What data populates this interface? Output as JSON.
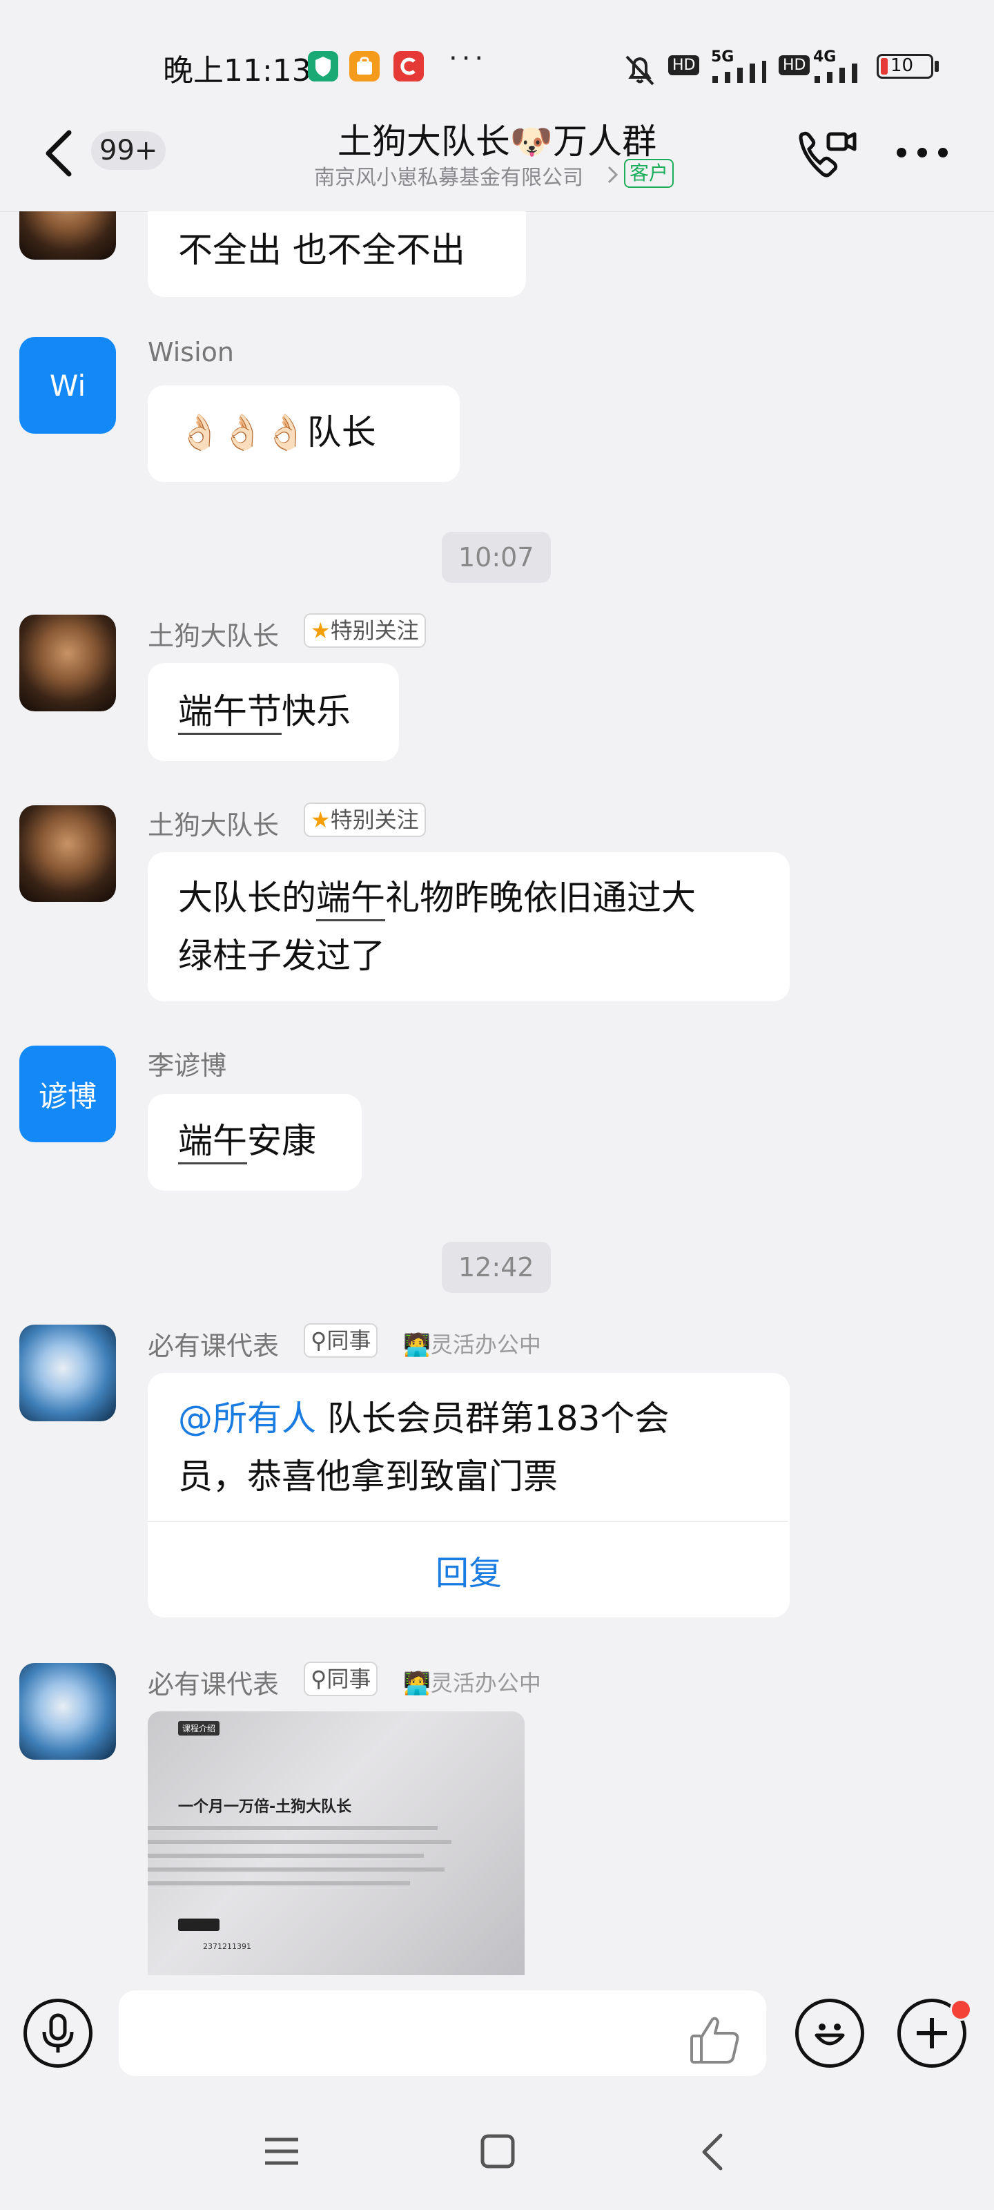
{
  "status_bar": {
    "time": "晚上11:13",
    "dots": "···",
    "net1": "5G",
    "net2": "4G",
    "battery": "10"
  },
  "header": {
    "unread_count": "99+",
    "title": "土狗大队长🐶万人群",
    "subtitle": "南京风小崽私募基金有限公司",
    "customer_tag": "客户"
  },
  "messages": [
    {
      "type": "text",
      "text": "不全出 也不全不出"
    },
    {
      "avatar_text": "Wi",
      "sender": "Wision",
      "text": "👌🏻👌🏻👌🏻队长"
    },
    {
      "type": "time",
      "text": "10:07"
    },
    {
      "sender": "土狗大队长",
      "tag": "特别关注",
      "underline": "端午节",
      "rest": "快乐"
    },
    {
      "sender": "土狗大队长",
      "tag": "特别关注",
      "line1_pre": "大队长的",
      "line1_ul": "端午",
      "line1_post": "礼物昨晚依旧通过大",
      "line2": "绿柱子发过了"
    },
    {
      "avatar_text": "谚博",
      "sender": "李谚博",
      "underline": "端午",
      "rest": "安康"
    },
    {
      "type": "time",
      "text": "12:42"
    },
    {
      "sender": "必有课代表",
      "tag": "同事",
      "status": "灵活办公中",
      "mention": "@所有人",
      "line1": " 队长会员群第183个会",
      "line2": "员，恭喜他拿到致富门票",
      "reply": "回复"
    },
    {
      "sender": "必有课代表",
      "tag": "同事",
      "status": "灵活办公中",
      "image_title": "一个月一万倍-土狗大队长",
      "image_tab": "课程介绍",
      "image_code": "2371211391"
    }
  ],
  "input": {
    "placeholder": ""
  },
  "colors": {
    "accent": "#1a7be0",
    "background": "#f2f2f4",
    "customer_green": "#1aad5a",
    "avatar_blue": "#1389f7"
  }
}
